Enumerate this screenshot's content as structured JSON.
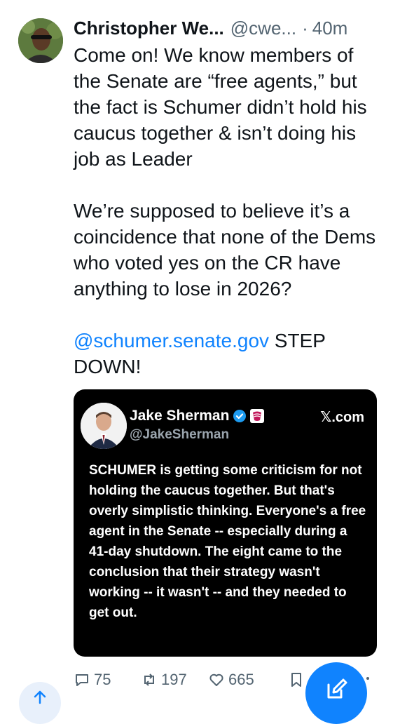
{
  "post": {
    "author_name": "Christopher We...",
    "author_handle": "@cwe...",
    "separator": "·",
    "time": "40m",
    "paragraph1": "Come on! We know members of the Senate are “free agents,” but the fact is Schumer didn’t hold his caucus together & isn’t doing his job as Leader",
    "paragraph2": "We’re supposed to believe it’s a coincidence that none of the Dems who voted yes on the CR have anything to lose in 2026?",
    "mention": "@schumer.senate.gov",
    "paragraph3_tail": " STEP DOWN!"
  },
  "quote": {
    "name": "Jake Sherman",
    "handle": "@JakeSherman",
    "source": "𝕏.com",
    "text": "SCHUMER is getting some criticism for not holding the caucus together. But that's overly simplistic thinking. Everyone's a free agent in the Senate -- especially during a 41-day shutdown. The eight came to the conclusion that their strategy wasn't working -- it wasn't -- and they needed to get out."
  },
  "actions": {
    "replies": "75",
    "reposts": "197",
    "likes": "665"
  },
  "icons": {
    "reply": "reply-icon",
    "repost": "repost-icon",
    "like": "heart-icon",
    "bookmark": "bookmark-icon",
    "compose": "compose-icon",
    "scroll_top": "arrow-up-icon",
    "verified": "verified-badge-icon"
  },
  "colors": {
    "link": "#1083fe",
    "muted": "#536471",
    "card_bg": "#000000",
    "fab": "#1083fe"
  }
}
